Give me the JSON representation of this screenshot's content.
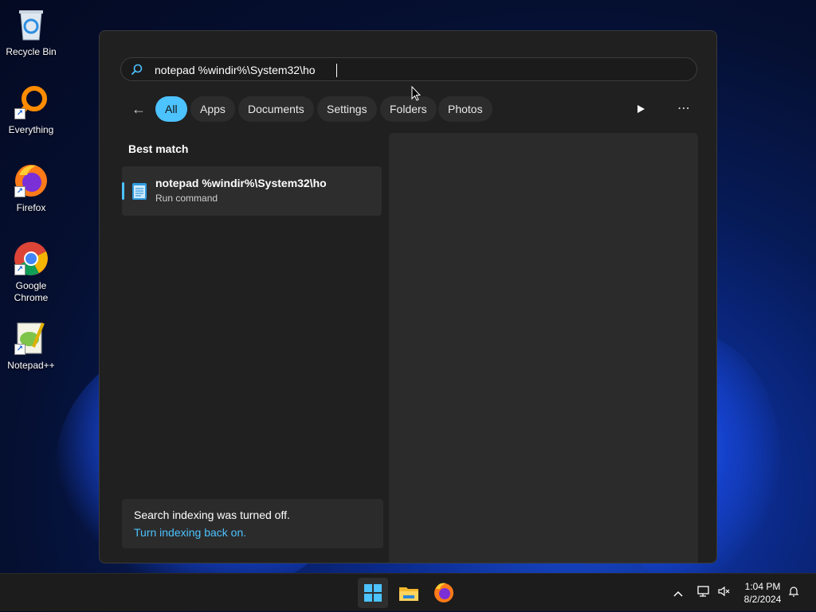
{
  "desktop": {
    "icons": [
      {
        "label": "Recycle Bin"
      },
      {
        "label": "Everything"
      },
      {
        "label": "Firefox"
      },
      {
        "label": "Google Chrome"
      },
      {
        "label": "Notepad++"
      }
    ]
  },
  "search": {
    "query": "notepad %windir%\\System32\\ho",
    "filters": [
      "All",
      "Apps",
      "Documents",
      "Settings",
      "Folders",
      "Photos"
    ],
    "active_filter": "All",
    "best_match_title": "Best match",
    "result": {
      "title": "notepad %windir%\\System32\\ho",
      "subtitle": "Run command"
    },
    "notice": {
      "message": "Search indexing was turned off.",
      "link": "Turn indexing back on."
    }
  },
  "taskbar": {
    "time": "1:04 PM",
    "date": "8/2/2024",
    "apps": [
      "start-icon",
      "file-explorer-icon",
      "firefox-icon"
    ]
  },
  "colors": {
    "accent": "#4cc2ff",
    "flyout_bg": "#202020",
    "taskbar_bg": "#1c1c1c"
  }
}
